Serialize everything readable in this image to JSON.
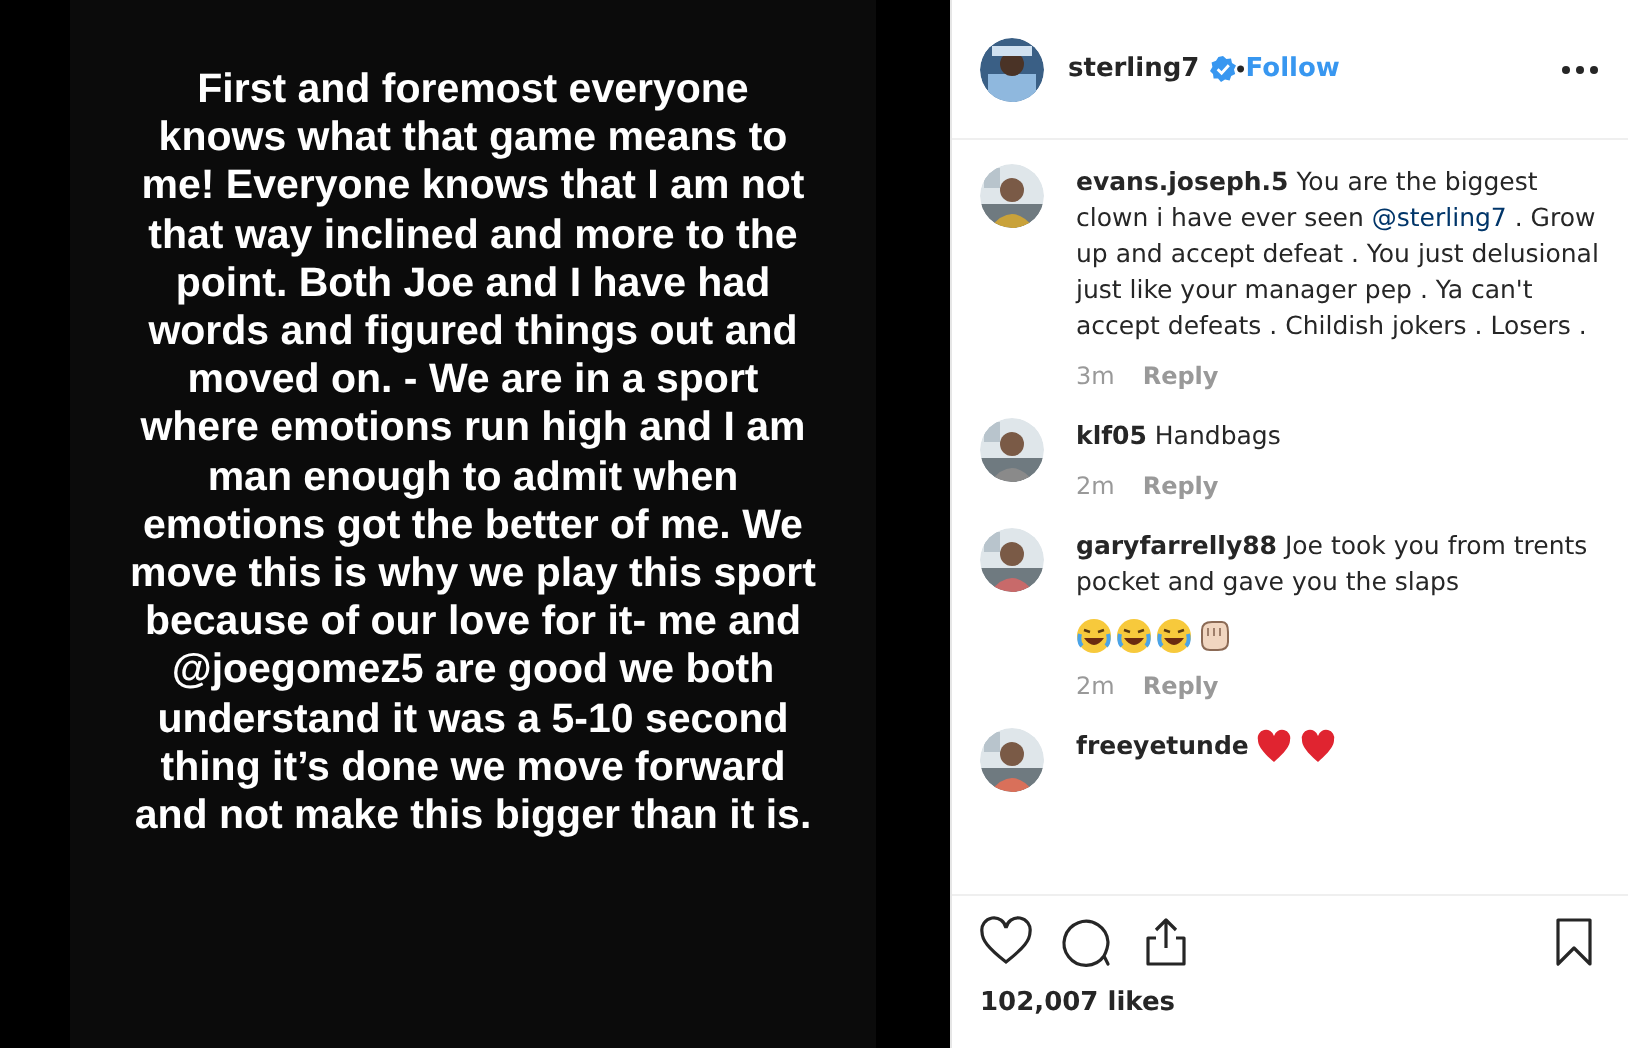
{
  "story": {
    "text": "First and foremost everyone knows what that game means to me!  Everyone knows that I am not that way inclined and more to the point. Both Joe and I have had words and figured things out and moved on. - We are in a sport where emotions run high and I am man enough to admit when emotions got the better of me. We move this is why we play this sport because of our love for it- me and @joegomez5 are good we both understand it was a 5-10 second thing it’s done we move forward and not make this bigger  than it is."
  },
  "header": {
    "username": "sterling7",
    "verified": true,
    "separator": "•",
    "follow": "Follow"
  },
  "comments": [
    {
      "username": "evans.joseph.5",
      "text": "You are the biggest clown i have ever seen ",
      "mention": "@sterling7",
      "after": " . Grow up and accept defeat . You just delusional just like your manager pep . Ya can't accept defeats . Childish jokers . Losers .",
      "time": "3m",
      "reply": "Reply"
    },
    {
      "username": "klf05",
      "text": "Handbags",
      "time": "2m",
      "reply": "Reply"
    },
    {
      "username": "garyfarrelly88",
      "text": "Joe took you from trents pocket and gave you the slaps",
      "icons": [
        {
          "kind": "laugh"
        },
        {
          "kind": "laugh"
        },
        {
          "kind": "laugh"
        },
        {
          "kind": "fist"
        }
      ],
      "time": "2m",
      "reply": "Reply"
    },
    {
      "username": "freeyetunde",
      "icons": [
        {
          "kind": "heart"
        },
        {
          "kind": "heart"
        }
      ]
    }
  ],
  "likes": "102,007 likes"
}
